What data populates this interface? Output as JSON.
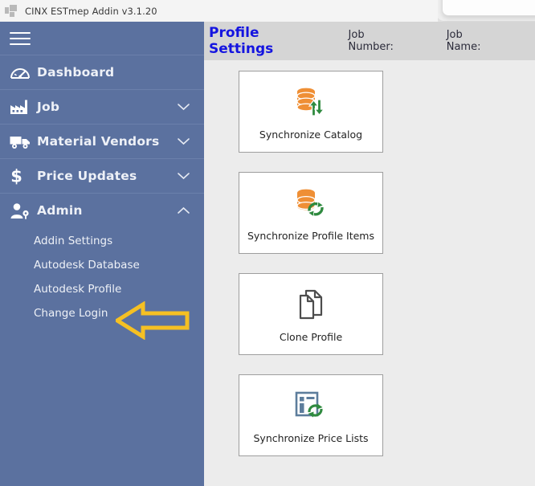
{
  "window": {
    "title": "CINX ESTmep Addin v3.1.20",
    "icon": "app-window-icon"
  },
  "sidebar": {
    "menu_toggle": "hamburger-menu-icon",
    "items": [
      {
        "label": "Dashboard",
        "icon": "gauge-icon",
        "chevron": "",
        "expanded": false
      },
      {
        "label": "Job",
        "icon": "factory-icon",
        "chevron": "∨",
        "expanded": false
      },
      {
        "label": "Material Vendors",
        "icon": "truck-icon",
        "chevron": "∨",
        "expanded": false
      },
      {
        "label": "Price Updates",
        "icon": "dollar-icon",
        "chevron": "∨",
        "expanded": false
      },
      {
        "label": "Admin",
        "icon": "user-gear-icon",
        "chevron": "∧",
        "expanded": true
      }
    ],
    "admin_submenu": [
      {
        "label": "Addin Settings"
      },
      {
        "label": "Autodesk Database"
      },
      {
        "label": "Autodesk Profile"
      },
      {
        "label": "Change Login"
      }
    ],
    "annotation": {
      "type": "arrow-left",
      "points_to": "Autodesk Profile",
      "color": "#f5c023"
    },
    "colors": {
      "background": "#5b719f",
      "divider": "#6b80ab",
      "text": "#eef1f7"
    }
  },
  "header": {
    "title": "Profile Settings",
    "title_color": "#1414e0",
    "job_number_label": "Job Number:",
    "job_number_value": "",
    "job_name_label": "Job Name:",
    "job_name_value": "",
    "background": "#d5d5d5"
  },
  "main": {
    "cards": [
      {
        "label": "Synchronize Catalog",
        "icon": "database-sync-arrows-icon"
      },
      {
        "label": "Synchronize Profile Items",
        "icon": "database-refresh-icon"
      },
      {
        "label": "Clone Profile",
        "icon": "copy-documents-icon"
      },
      {
        "label": "Synchronize Price Lists",
        "icon": "price-list-refresh-icon"
      }
    ],
    "colors": {
      "card_background": "#ffffff",
      "card_border": "#9e9e9e",
      "content_background": "#ececec",
      "icon_orange": "#ef8f35",
      "icon_green": "#2f8a3f",
      "icon_gray": "#4d4d4d",
      "icon_blue_gray": "#5d7d9c"
    }
  }
}
